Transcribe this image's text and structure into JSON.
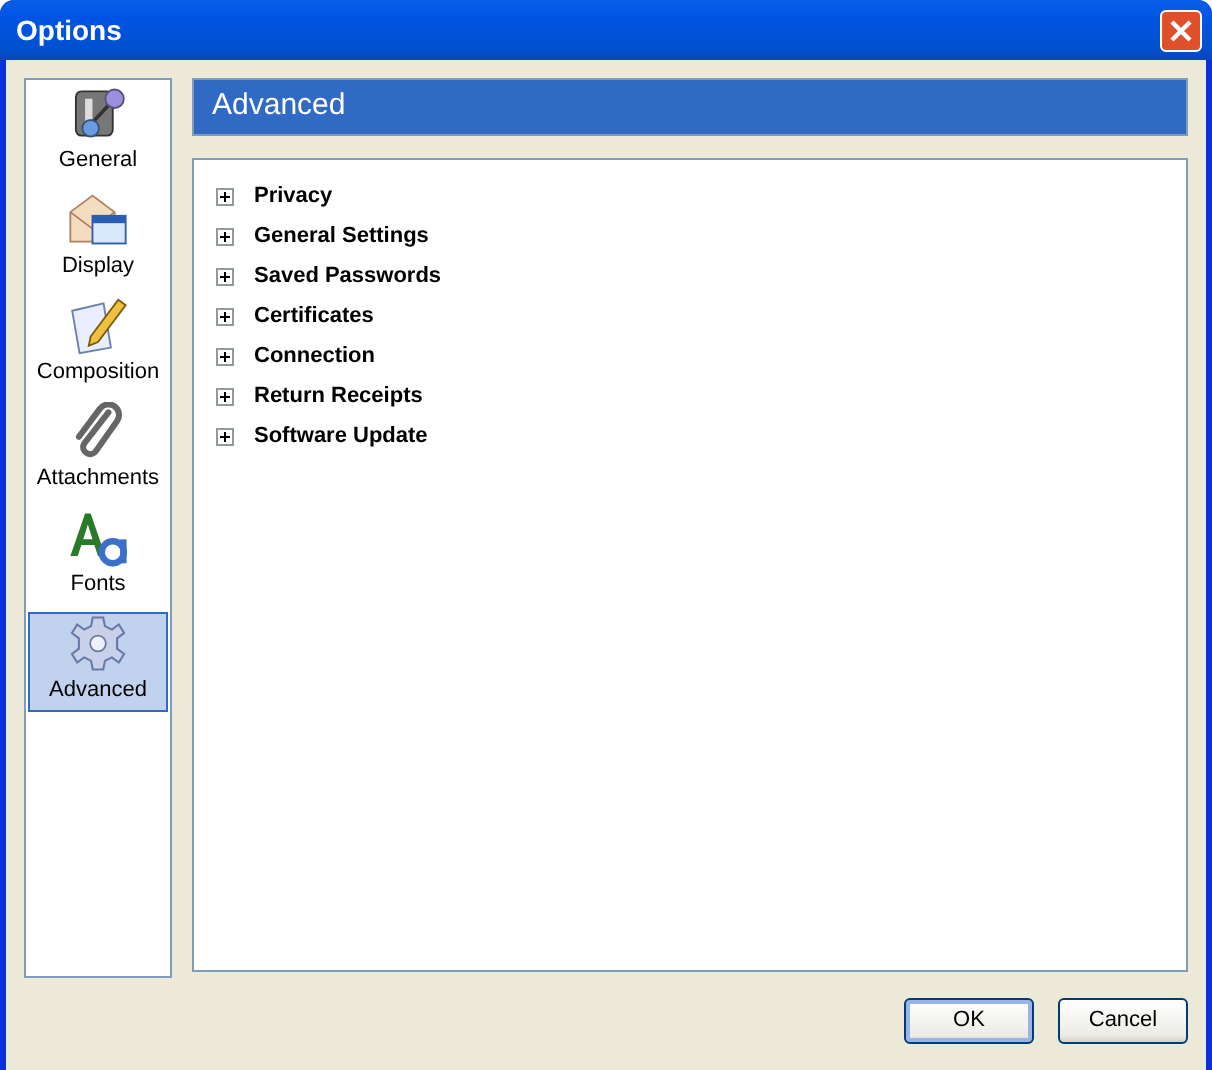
{
  "window": {
    "title": "Options"
  },
  "sidebar": {
    "items": [
      {
        "label": "General",
        "selected": false
      },
      {
        "label": "Display",
        "selected": false
      },
      {
        "label": "Composition",
        "selected": false
      },
      {
        "label": "Attachments",
        "selected": false
      },
      {
        "label": "Fonts",
        "selected": false
      },
      {
        "label": "Advanced",
        "selected": true
      }
    ]
  },
  "panel": {
    "title": "Advanced",
    "tree": [
      {
        "label": "Privacy",
        "expanded": false
      },
      {
        "label": "General Settings",
        "expanded": false
      },
      {
        "label": "Saved Passwords",
        "expanded": false
      },
      {
        "label": "Certificates",
        "expanded": false
      },
      {
        "label": "Connection",
        "expanded": false
      },
      {
        "label": "Return Receipts",
        "expanded": false
      },
      {
        "label": "Software Update",
        "expanded": false
      }
    ]
  },
  "buttons": [
    {
      "label": "OK",
      "kind": "default"
    },
    {
      "label": "Cancel",
      "kind": "normal"
    }
  ]
}
